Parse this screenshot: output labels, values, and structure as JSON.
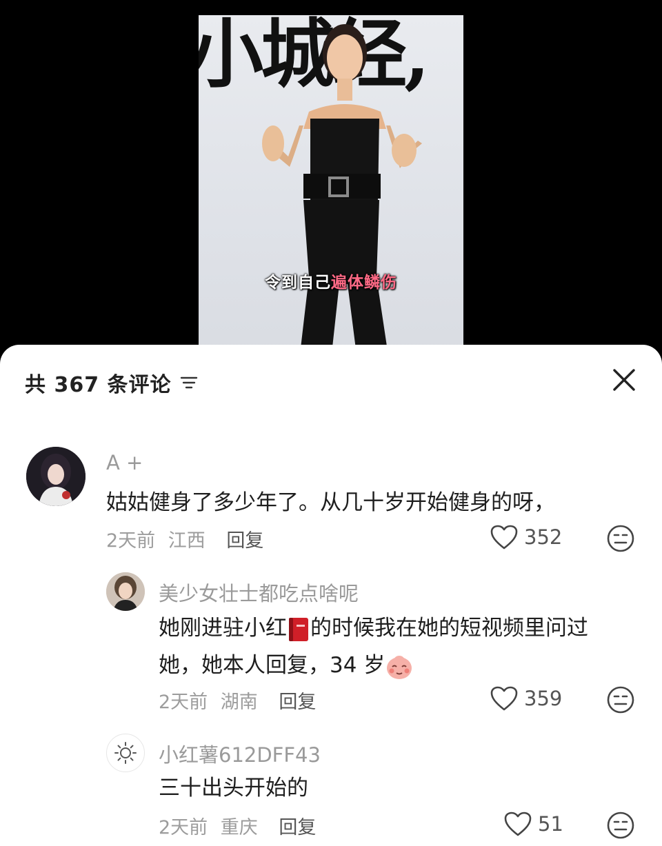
{
  "video": {
    "title_text": "小城经,",
    "subtitle_prefix": "令到自己",
    "subtitle_highlight": "遍体鳞伤"
  },
  "sheet": {
    "count_label": "共 367 条评论",
    "sort_icon": "filter-icon",
    "close_icon": "close-icon"
  },
  "comments": [
    {
      "author": "A +",
      "text": "姑姑健身了多少年了。从几十岁开始健身的呀，",
      "time": "2天前",
      "location": "江西",
      "reply_label": "回复",
      "likes": "352"
    },
    {
      "author": "美少女壮士都吃点啥呢",
      "text_line1_prefix": "她刚进驻小红",
      "text_line1_suffix": "的时候我在她的短视频里问过",
      "text_line2": "她，她本人回复，34 岁",
      "time": "2天前",
      "location": "湖南",
      "reply_label": "回复",
      "likes": "359"
    },
    {
      "author": "小红薯612DFF43",
      "text": "三十出头开始的",
      "time": "2天前",
      "location": "重庆",
      "reply_label": "回复",
      "likes": "51"
    }
  ],
  "colors": {
    "subtitle_highlight": "#ff6a86",
    "text_primary": "#1e1e1e",
    "text_secondary": "#9a9a9a"
  }
}
